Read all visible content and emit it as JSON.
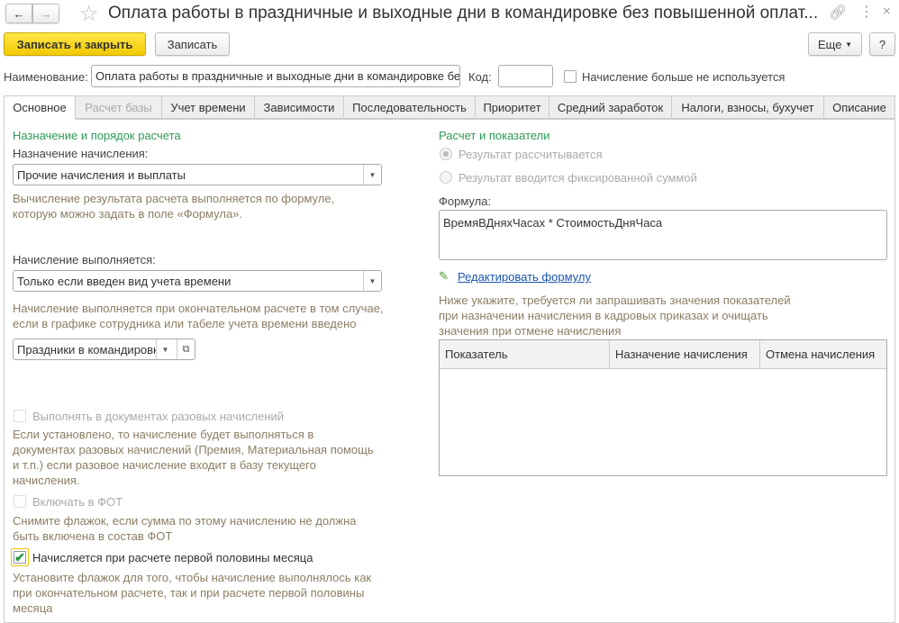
{
  "title": "Оплата работы в праздничные и выходные дни в командировке без повышенной оплат...",
  "toolbar": {
    "save_close": "Записать и закрыть",
    "save": "Записать",
    "more": "Еще",
    "help": "?"
  },
  "header": {
    "name_label": "Наименование:",
    "name_value": "Оплата работы в праздничные и выходные дни в командировке бе",
    "code_label": "Код:",
    "code_value": "",
    "unused_label": "Начисление больше не используется"
  },
  "tabs": [
    "Основное",
    "Расчет базы",
    "Учет времени",
    "Зависимости",
    "Последовательность",
    "Приоритет",
    "Средний заработок",
    "Налоги, взносы, бухучет",
    "Описание"
  ],
  "left": {
    "section": "Назначение и порядок расчета",
    "purpose_label": "Назначение начисления:",
    "purpose_value": "Прочие начисления и выплаты",
    "purpose_hint": [
      "Вычисление результата расчета выполняется по формуле,",
      "которую можно задать в поле «Формула»."
    ],
    "exec_label": "Начисление выполняется:",
    "exec_value": "Только если введен вид учета времени",
    "exec_hint": [
      "Начисление выполняется при окончательном расчете в том случае,",
      "если в графике сотрудника или табеле учета времени введено"
    ],
    "time_type_value": "Праздники в командировк",
    "onetime_label": "Выполнять в документах разовых начислений",
    "onetime_hint": [
      "Если установлено, то начисление будет выполняться в",
      "документах разовых начислений (Премия, Материальная помощь",
      "и т.п.) если разовое начисление входит в базу текущего",
      "начисления."
    ],
    "fot_label": "Включать в ФОТ",
    "fot_hint": [
      "Снимите флажок, если сумма по этому начислению не должна",
      "быть включена в состав ФОТ"
    ],
    "first_half_label": "Начисляется при расчете первой половины месяца",
    "first_half_checked": true,
    "first_half_hint": [
      "Установите флажок для того, чтобы начисление выполнялось как",
      "при окончательном расчете, так и при расчете первой половины",
      "месяца"
    ]
  },
  "right": {
    "section": "Расчет и показатели",
    "radio1": "Результат рассчитывается",
    "radio2": "Результат вводится фиксированной суммой",
    "formula_label": "Формула:",
    "formula_value": "ВремяВДняхЧасах * СтоимостьДняЧаса",
    "edit_formula": "Редактировать формулу",
    "indicators_hint": [
      "Ниже укажите, требуется ли запрашивать значения показателей",
      "при назначении начисления в кадровых приказах и очищать",
      "значения при отмене начисления"
    ],
    "table_headers": [
      "Показатель",
      "Назначение начисления",
      "Отмена начисления"
    ]
  }
}
